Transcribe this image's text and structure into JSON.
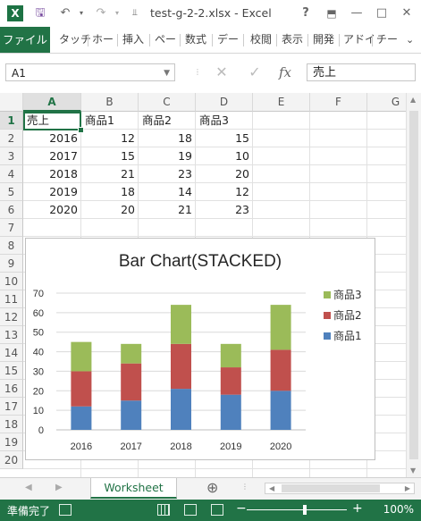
{
  "window": {
    "title": "test-g-2-2.xlsx - Excel",
    "help": "?",
    "min": "—",
    "restore": "□",
    "close": "✕"
  },
  "ribbon": {
    "file": "ファイル",
    "tabs": [
      "タッチ",
      "ホー",
      "挿入",
      "ペー",
      "数式",
      "デー",
      "校閲",
      "表示",
      "開発",
      "アドイ",
      "チー"
    ]
  },
  "formula_bar": {
    "name_box": "A1",
    "fx": "fx",
    "value": "売上"
  },
  "columns": [
    "A",
    "B",
    "C",
    "D",
    "E",
    "F",
    "G"
  ],
  "rows": [
    "1",
    "2",
    "3",
    "4",
    "5",
    "6",
    "7",
    "8",
    "9",
    "10",
    "11",
    "12",
    "13",
    "14",
    "15",
    "16",
    "17",
    "18",
    "19",
    "20"
  ],
  "cells": {
    "header": [
      "売上",
      "商品1",
      "商品2",
      "商品3"
    ],
    "data": [
      [
        "2016",
        "12",
        "18",
        "15"
      ],
      [
        "2017",
        "15",
        "19",
        "10"
      ],
      [
        "2018",
        "21",
        "23",
        "20"
      ],
      [
        "2019",
        "18",
        "14",
        "12"
      ],
      [
        "2020",
        "20",
        "21",
        "23"
      ]
    ]
  },
  "chart_data": {
    "type": "bar",
    "stacked": true,
    "title": "Bar Chart(STACKED)",
    "categories": [
      "2016",
      "2017",
      "2018",
      "2019",
      "2020"
    ],
    "series": [
      {
        "name": "商品1",
        "values": [
          12,
          15,
          21,
          18,
          20
        ],
        "color": "#4f81bd"
      },
      {
        "name": "商品2",
        "values": [
          18,
          19,
          23,
          14,
          21
        ],
        "color": "#c0504d"
      },
      {
        "name": "商品3",
        "values": [
          15,
          10,
          20,
          12,
          23
        ],
        "color": "#9bbb59"
      }
    ],
    "ylim": [
      0,
      70
    ],
    "yticks": [
      0,
      10,
      20,
      30,
      40,
      50,
      60,
      70
    ],
    "grid": true,
    "legend": "right"
  },
  "sheets": {
    "active": "Worksheet",
    "add": "⊕"
  },
  "status": {
    "text": "準備完了",
    "zoom": "100%",
    "zoom_minus": "−",
    "zoom_plus": "+"
  }
}
